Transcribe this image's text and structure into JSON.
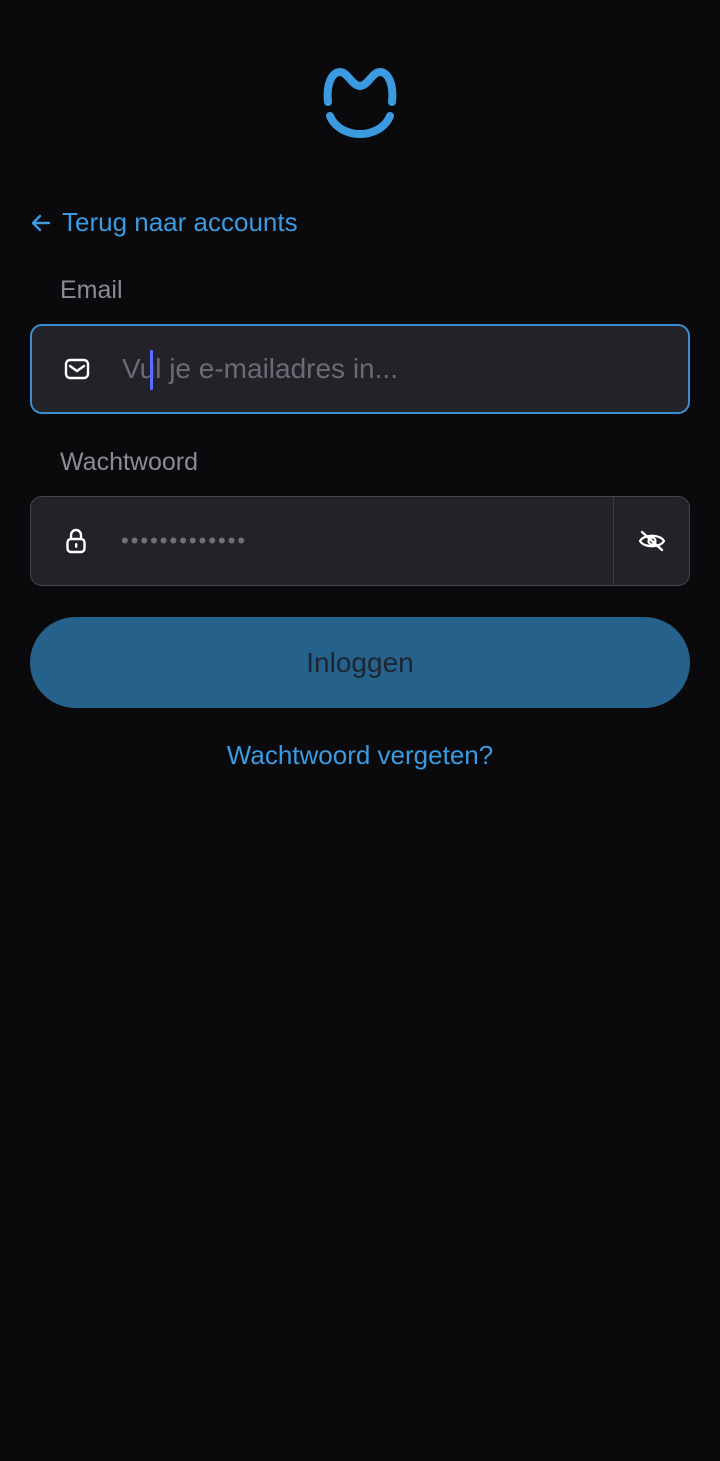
{
  "logo": {
    "icon": "smile-m-logo",
    "color": "#3b9ae0"
  },
  "back_link": {
    "label": "Terug naar accounts",
    "icon": "arrow-left-icon"
  },
  "email": {
    "label": "Email",
    "placeholder": "Vul je e-mailadres in...",
    "value": "",
    "icon": "mail-icon"
  },
  "password": {
    "label": "Wachtwoord",
    "masked_value": "•••••••••••••",
    "icon": "lock-icon",
    "toggle_icon": "eye-off-icon"
  },
  "login_button": {
    "label": "Inloggen"
  },
  "forgot_link": {
    "label": "Wachtwoord vergeten?"
  },
  "colors": {
    "background": "#0a0a0c",
    "accent": "#3b9ae0",
    "button": "#26618c",
    "input_bg": "#222228"
  }
}
